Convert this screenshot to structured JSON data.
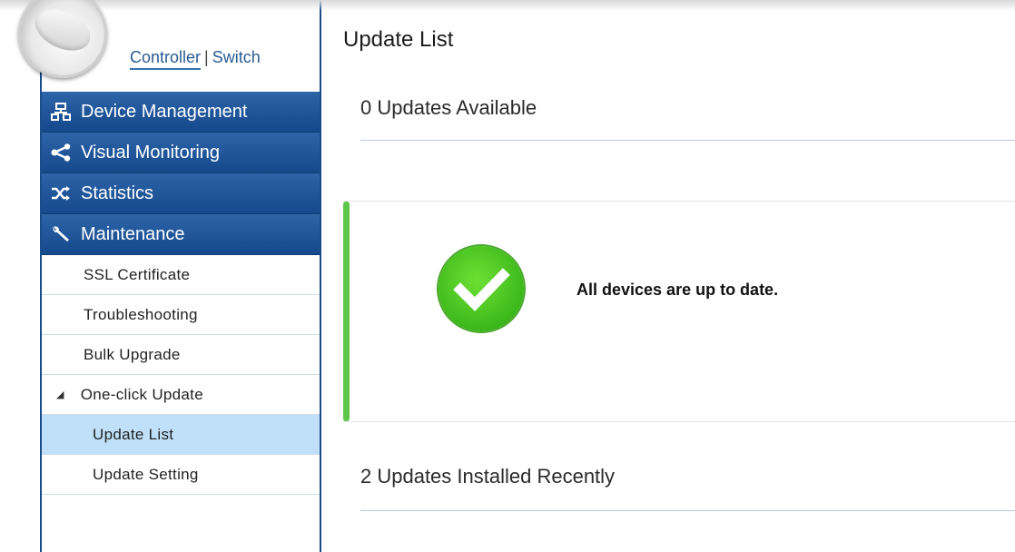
{
  "header": {
    "mode_controller": "Controller",
    "mode_separator": "|",
    "mode_switch": "Switch"
  },
  "sidebar": {
    "sections": [
      {
        "label": "Device Management",
        "icon": "network-icon"
      },
      {
        "label": "Visual Monitoring",
        "icon": "share-icon"
      },
      {
        "label": "Statistics",
        "icon": "shuffle-icon"
      },
      {
        "label": "Maintenance",
        "icon": "wrench-icon"
      }
    ],
    "maintenance_items": [
      {
        "label": "SSL Certificate"
      },
      {
        "label": "Troubleshooting"
      },
      {
        "label": "Bulk Upgrade"
      },
      {
        "label": "One-click Update",
        "expanded": true
      }
    ],
    "one_click_items": [
      {
        "label": "Update List",
        "selected": true
      },
      {
        "label": "Update Setting",
        "selected": false
      }
    ]
  },
  "main": {
    "title": "Update List",
    "available_heading": "0 Updates Available",
    "status_message": "All devices are up to date.",
    "installed_heading": "2 Updates Installed Recently"
  },
  "colors": {
    "nav_blue": "#1a4d8c",
    "selected_bg": "#bfe0f8",
    "success_green": "#3cb81b",
    "status_bar_green": "#5cc64a"
  }
}
